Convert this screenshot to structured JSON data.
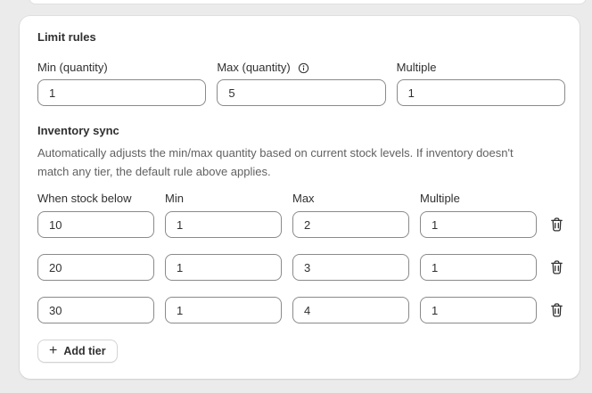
{
  "colors": {
    "page_bg": "#ebebeb",
    "card_bg": "#ffffff",
    "input_border": "#8a8a8a",
    "text_primary": "#303030",
    "text_subdued": "#616161",
    "button_border": "#d4d4d4"
  },
  "limit_rules": {
    "title": "Limit rules",
    "fields": [
      {
        "label": "Min (quantity)",
        "value": "1"
      },
      {
        "label": "Max (quantity)",
        "value": "5",
        "info_icon": "info-circle-icon"
      },
      {
        "label": "Multiple",
        "value": "1"
      }
    ]
  },
  "inventory_sync": {
    "title": "Inventory sync",
    "description_lines": [
      "Automatically adjusts the min/max quantity based on current stock levels. If inventory doesn't",
      "match any tier, the default rule above applies."
    ],
    "columns": [
      "When stock below",
      "Min",
      "Max",
      "Multiple"
    ],
    "tiers": [
      {
        "stock_below": "10",
        "min": "1",
        "max": "2",
        "multiple": "1"
      },
      {
        "stock_below": "20",
        "min": "1",
        "max": "3",
        "multiple": "1"
      },
      {
        "stock_below": "30",
        "min": "1",
        "max": "4",
        "multiple": "1"
      }
    ],
    "add_tier_button": {
      "plus": "+",
      "label": "Add tier"
    }
  }
}
